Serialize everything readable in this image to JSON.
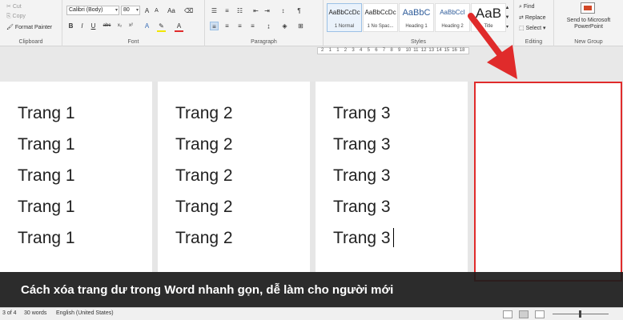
{
  "ribbon": {
    "clipboard": {
      "cut": "Cut",
      "copy": "Copy",
      "format_painter": "Format Painter",
      "label": "Clipboard"
    },
    "font": {
      "name": "Calibri (Body)",
      "size": "80",
      "change_case": "Aa",
      "label": "Font"
    },
    "paragraph": {
      "label": "Paragraph"
    },
    "styles": {
      "items": [
        {
          "preview": "AaBbCcDc",
          "name": "1 Normal"
        },
        {
          "preview": "AaBbCcDc",
          "name": "1 No Spac..."
        },
        {
          "preview": "AaBbC",
          "name": "Heading 1"
        },
        {
          "preview": "AaBbCcI",
          "name": "Heading 2"
        },
        {
          "preview": "AaB",
          "name": "Title"
        }
      ],
      "label": "Styles"
    },
    "editing": {
      "find": "Find",
      "replace": "Replace",
      "select": "Select",
      "label": "Editing"
    },
    "new_group": {
      "button": "Send to Microsoft PowerPoint",
      "label": "New Group"
    }
  },
  "ruler": {
    "ticks": [
      "2",
      "1",
      "1",
      "2",
      "3",
      "4",
      "5",
      "6",
      "7",
      "8",
      "9",
      "10",
      "11",
      "12",
      "13",
      "14",
      "15",
      "16",
      "18"
    ]
  },
  "pages": [
    {
      "lines": [
        "Trang 1",
        "Trang 1",
        "Trang 1",
        "Trang 1",
        "Trang 1"
      ]
    },
    {
      "lines": [
        "Trang 2",
        "Trang 2",
        "Trang 2",
        "Trang 2",
        "Trang 2"
      ]
    },
    {
      "lines": [
        "Trang 3",
        "Trang 3",
        "Trang 3",
        "Trang 3",
        "Trang 3"
      ]
    }
  ],
  "caption": "Cách xóa trang dư trong Word nhanh gọn, dễ làm cho người mới",
  "statusbar": {
    "page": "3 of 4",
    "words": "30 words",
    "language": "English (United States)"
  },
  "colors": {
    "highlight_red": "#e02b2b",
    "caption_bg": "#1c1c1c",
    "ribbon_bg": "#f3f3f3"
  }
}
